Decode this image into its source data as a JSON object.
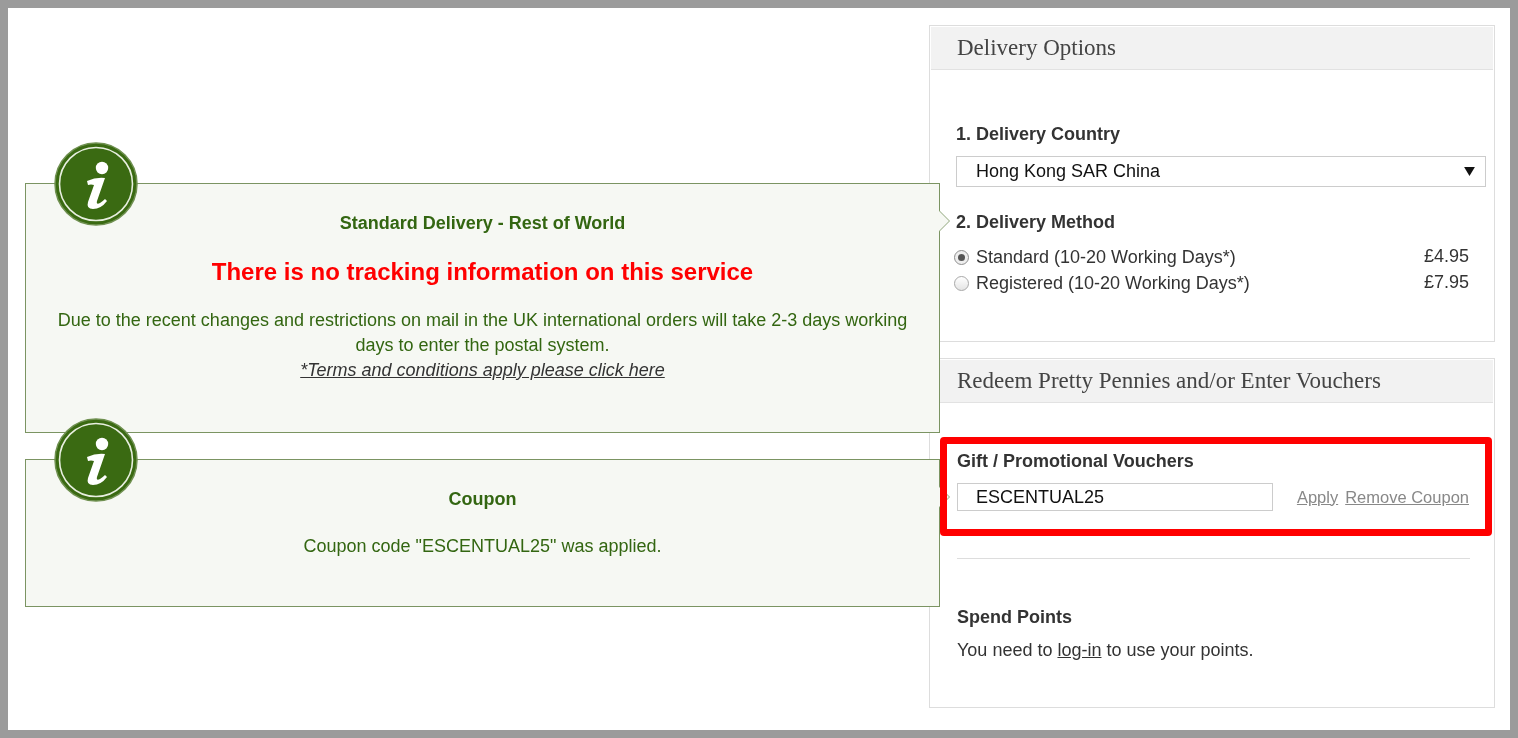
{
  "notices": [
    {
      "title": "Standard Delivery - Rest of World",
      "alert": "There is no tracking information on this service",
      "message": "Due to the recent changes and restrictions on mail in the UK international orders will take 2-3 days working days to enter the postal system.",
      "link": "*Terms and conditions apply please click here"
    },
    {
      "title": "Coupon",
      "message": "Coupon code \"ESCENTUAL25\" was applied."
    }
  ],
  "delivery_options": {
    "title": "Delivery Options",
    "country_label": "1. Delivery Country",
    "country": "Hong Kong SAR China",
    "method_label": "2. Delivery Method",
    "methods": [
      {
        "label": "Standard (10-20 Working Days*)",
        "price": "£4.95",
        "selected": true
      },
      {
        "label": "Registered (10-20 Working Days*)",
        "price": "£7.95",
        "selected": false
      }
    ]
  },
  "vouchers": {
    "title": "Redeem Pretty Pennies and/or Enter Vouchers",
    "highlighted": true,
    "voucher_label": "Gift / Promotional Vouchers",
    "code": "ESCENTUAL25",
    "apply": "Apply",
    "remove": "Remove Coupon",
    "points_title": "Spend Points",
    "points_before": "You need to",
    "login": "log-in",
    "points_after": "to use your points."
  }
}
